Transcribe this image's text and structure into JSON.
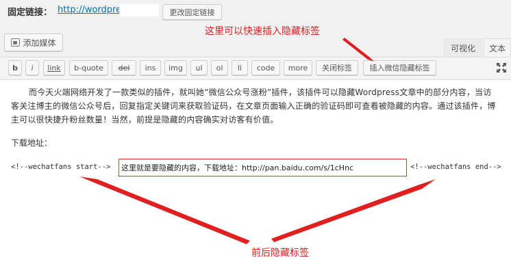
{
  "permalink": {
    "label": "固定链接：",
    "url_text": "http://wordpre",
    "change_button": "更改固定链接"
  },
  "media": {
    "add_label": "添加媒体",
    "icon": "media-icon"
  },
  "tabs": {
    "visual": "可视化",
    "text": "文本"
  },
  "toolbar": {
    "buttons": [
      "b",
      "i",
      "link",
      "b-quote",
      "del",
      "ins",
      "img",
      "ul",
      "ol",
      "li",
      "code",
      "more",
      "关闭标签",
      "插入微信隐藏标签"
    ],
    "fullscreen_icon": "fullscreen-icon"
  },
  "content": {
    "paragraph": "而今天火端网络开发了一款类似的插件，就叫她“微信公众号涨粉”插件，该插件可以隐藏Wordpress文章中的部分内容，当访客关注博主的微信公众号后，回复指定关键词来获取验证码，在文章页面输入正确的验证码即可查看被隐藏的内容。通过该插件，博主可以很快捷升粉丝数量！当然，前提是隐藏的内容确实对访客有价值。",
    "download_label": "下载地址：",
    "start_tag": "<!--wechatfans start-->",
    "hidden_text": "这里就是要隐藏的内容，下载地址：http://pan.baidu.com/s/1cHnc",
    "end_tag": "<!--wechatfans end-->"
  },
  "annotations": {
    "top": "这里可以快速插入隐藏标签",
    "bottom": "前后隐藏标签",
    "color": "#e02020"
  }
}
